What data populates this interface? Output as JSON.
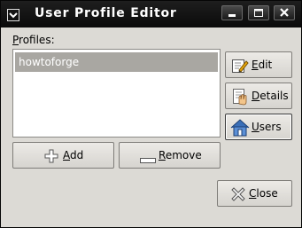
{
  "window": {
    "title": "User Profile Editor",
    "controls": [
      "minimize",
      "maximize",
      "close"
    ]
  },
  "profiles": {
    "label": "Profiles:",
    "items": [
      "howtoforge"
    ],
    "selected_index": 0
  },
  "buttons": {
    "edit": "Edit",
    "details": "Details",
    "users": "Users",
    "add": "Add",
    "remove": "Remove",
    "close": "Close"
  },
  "icons": {
    "title": "window-menu-icon",
    "edit": "edit-pencil-icon",
    "details": "details-icon",
    "users": "home-icon",
    "add": "add-plus-icon",
    "remove": "remove-minus-icon",
    "close": "close-x-icon"
  }
}
